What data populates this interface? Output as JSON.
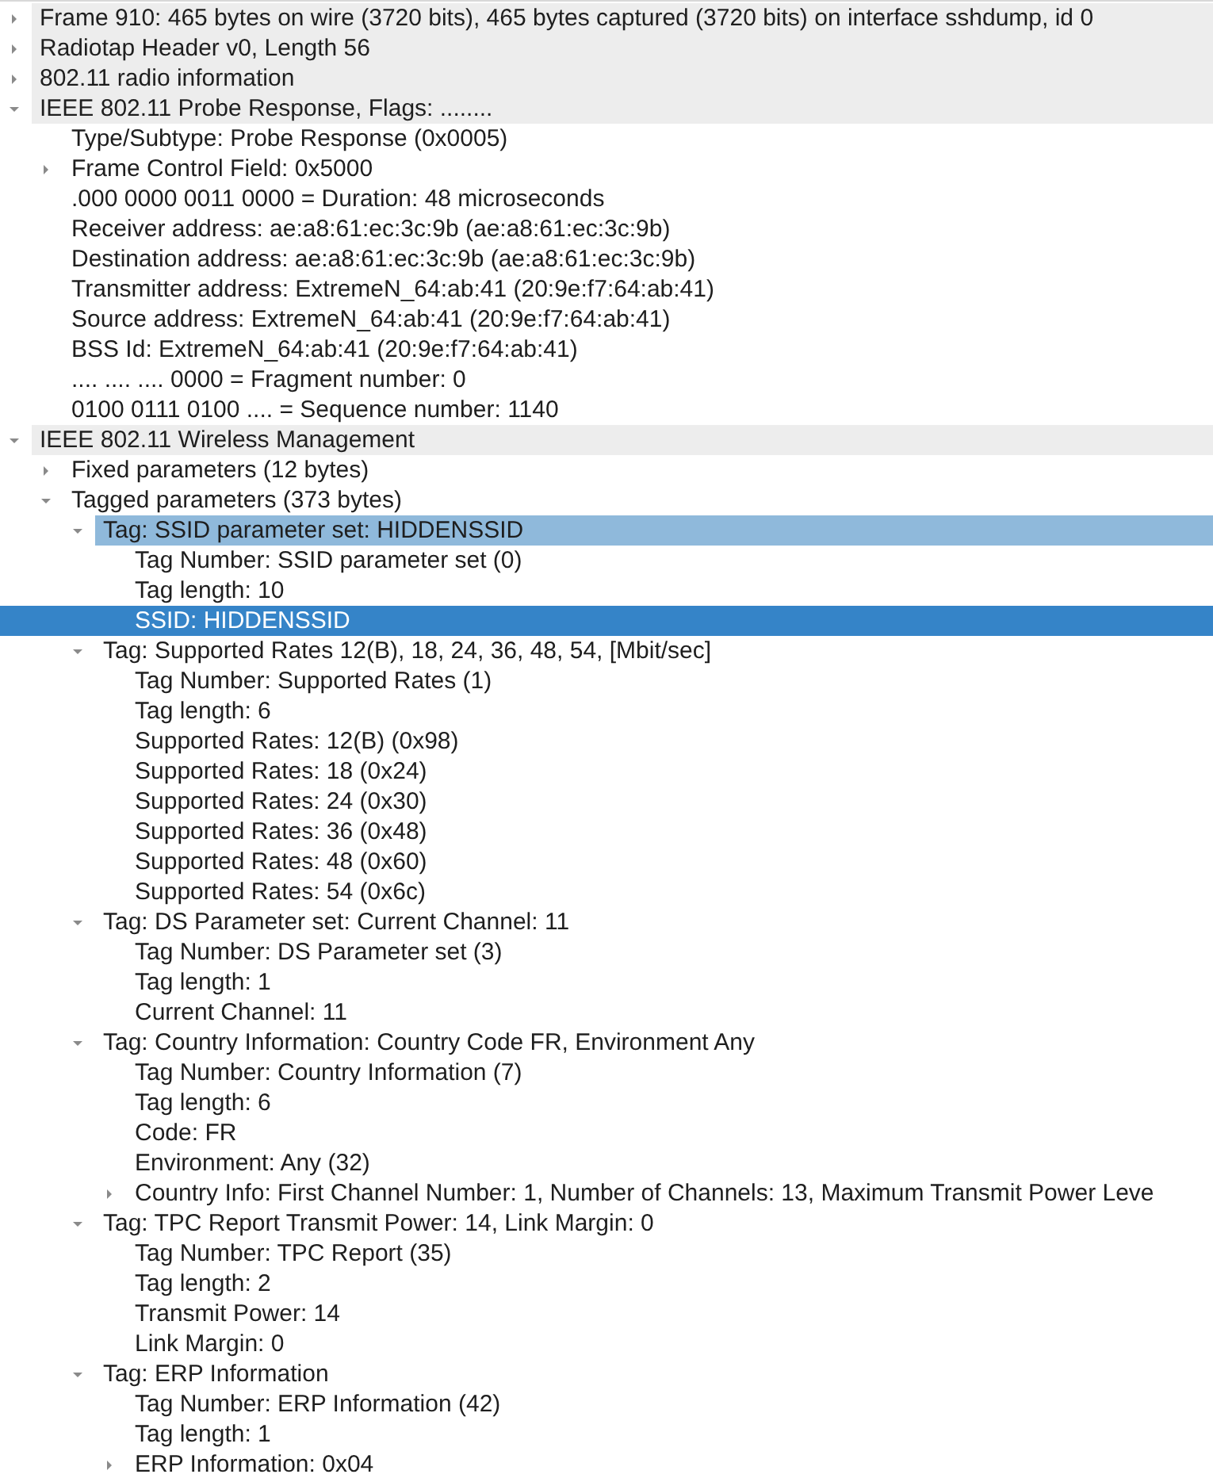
{
  "tree": [
    {
      "label": "Frame 910: 465 bytes on wire (3720 bits), 465 bytes captured (3720 bits) on interface sshdump, id 0",
      "expanded": false,
      "selected": false
    },
    {
      "label": "Radiotap Header v0, Length 56",
      "expanded": false,
      "selected": false
    },
    {
      "label": "802.11 radio information",
      "expanded": false,
      "selected": false
    },
    {
      "label": "IEEE 802.11 Probe Response, Flags: ........",
      "expanded": true,
      "selected": false,
      "children": [
        {
          "label": "Type/Subtype: Probe Response (0x0005)",
          "selected": false
        },
        {
          "label": "Frame Control Field: 0x5000",
          "expanded": false,
          "selected": false
        },
        {
          "label": ".000 0000 0011 0000 = Duration: 48 microseconds",
          "selected": false
        },
        {
          "label": "Receiver address: ae:a8:61:ec:3c:9b (ae:a8:61:ec:3c:9b)",
          "selected": false
        },
        {
          "label": "Destination address: ae:a8:61:ec:3c:9b (ae:a8:61:ec:3c:9b)",
          "selected": false
        },
        {
          "label": "Transmitter address: ExtremeN_64:ab:41 (20:9e:f7:64:ab:41)",
          "selected": false
        },
        {
          "label": "Source address: ExtremeN_64:ab:41 (20:9e:f7:64:ab:41)",
          "selected": false
        },
        {
          "label": "BSS Id: ExtremeN_64:ab:41 (20:9e:f7:64:ab:41)",
          "selected": false
        },
        {
          "label": ".... .... .... 0000 = Fragment number: 0",
          "selected": false
        },
        {
          "label": "0100 0111 0100 .... = Sequence number: 1140",
          "selected": false
        }
      ]
    },
    {
      "label": "IEEE 802.11 Wireless Management",
      "expanded": true,
      "selected": false,
      "children": [
        {
          "label": "Fixed parameters (12 bytes)",
          "expanded": false,
          "selected": false
        },
        {
          "label": "Tagged parameters (373 bytes)",
          "expanded": true,
          "selected": false,
          "children": [
            {
              "label": "Tag: SSID parameter set: HIDDENSSID",
              "expanded": true,
              "selected": false,
              "children": [
                {
                  "label": "Tag Number: SSID parameter set (0)",
                  "selected": false
                },
                {
                  "label": "Tag length: 10",
                  "selected": false
                },
                {
                  "label": "SSID: HIDDENSSID",
                  "selected": true
                }
              ]
            },
            {
              "label": "Tag: Supported Rates 12(B), 18, 24, 36, 48, 54, [Mbit/sec]",
              "expanded": true,
              "selected": false,
              "children": [
                {
                  "label": "Tag Number: Supported Rates (1)",
                  "selected": false
                },
                {
                  "label": "Tag length: 6",
                  "selected": false
                },
                {
                  "label": "Supported Rates: 12(B) (0x98)",
                  "selected": false
                },
                {
                  "label": "Supported Rates: 18 (0x24)",
                  "selected": false
                },
                {
                  "label": "Supported Rates: 24 (0x30)",
                  "selected": false
                },
                {
                  "label": "Supported Rates: 36 (0x48)",
                  "selected": false
                },
                {
                  "label": "Supported Rates: 48 (0x60)",
                  "selected": false
                },
                {
                  "label": "Supported Rates: 54 (0x6c)",
                  "selected": false
                }
              ]
            },
            {
              "label": "Tag: DS Parameter set: Current Channel: 11",
              "expanded": true,
              "selected": false,
              "children": [
                {
                  "label": "Tag Number: DS Parameter set (3)",
                  "selected": false
                },
                {
                  "label": "Tag length: 1",
                  "selected": false
                },
                {
                  "label": "Current Channel: 11",
                  "selected": false
                }
              ]
            },
            {
              "label": "Tag: Country Information: Country Code FR, Environment Any",
              "expanded": true,
              "selected": false,
              "children": [
                {
                  "label": "Tag Number: Country Information (7)",
                  "selected": false
                },
                {
                  "label": "Tag length: 6",
                  "selected": false
                },
                {
                  "label": "Code: FR",
                  "selected": false
                },
                {
                  "label": "Environment: Any (32)",
                  "selected": false
                },
                {
                  "label": "Country Info: First Channel Number: 1, Number of Channels: 13, Maximum Transmit Power Leve",
                  "expanded": false,
                  "selected": false
                }
              ]
            },
            {
              "label": "Tag: TPC Report Transmit Power: 14, Link Margin: 0",
              "expanded": true,
              "selected": false,
              "children": [
                {
                  "label": "Tag Number: TPC Report (35)",
                  "selected": false
                },
                {
                  "label": "Tag length: 2",
                  "selected": false
                },
                {
                  "label": "Transmit Power: 14",
                  "selected": false
                },
                {
                  "label": "Link Margin: 0",
                  "selected": false
                }
              ]
            },
            {
              "label": "Tag: ERP Information",
              "expanded": true,
              "selected": false,
              "children": [
                {
                  "label": "Tag Number: ERP Information (42)",
                  "selected": false
                },
                {
                  "label": "Tag length: 1",
                  "selected": false
                },
                {
                  "label": "ERP Information: 0x04",
                  "expanded": false,
                  "selected": false
                }
              ]
            }
          ]
        }
      ]
    }
  ]
}
